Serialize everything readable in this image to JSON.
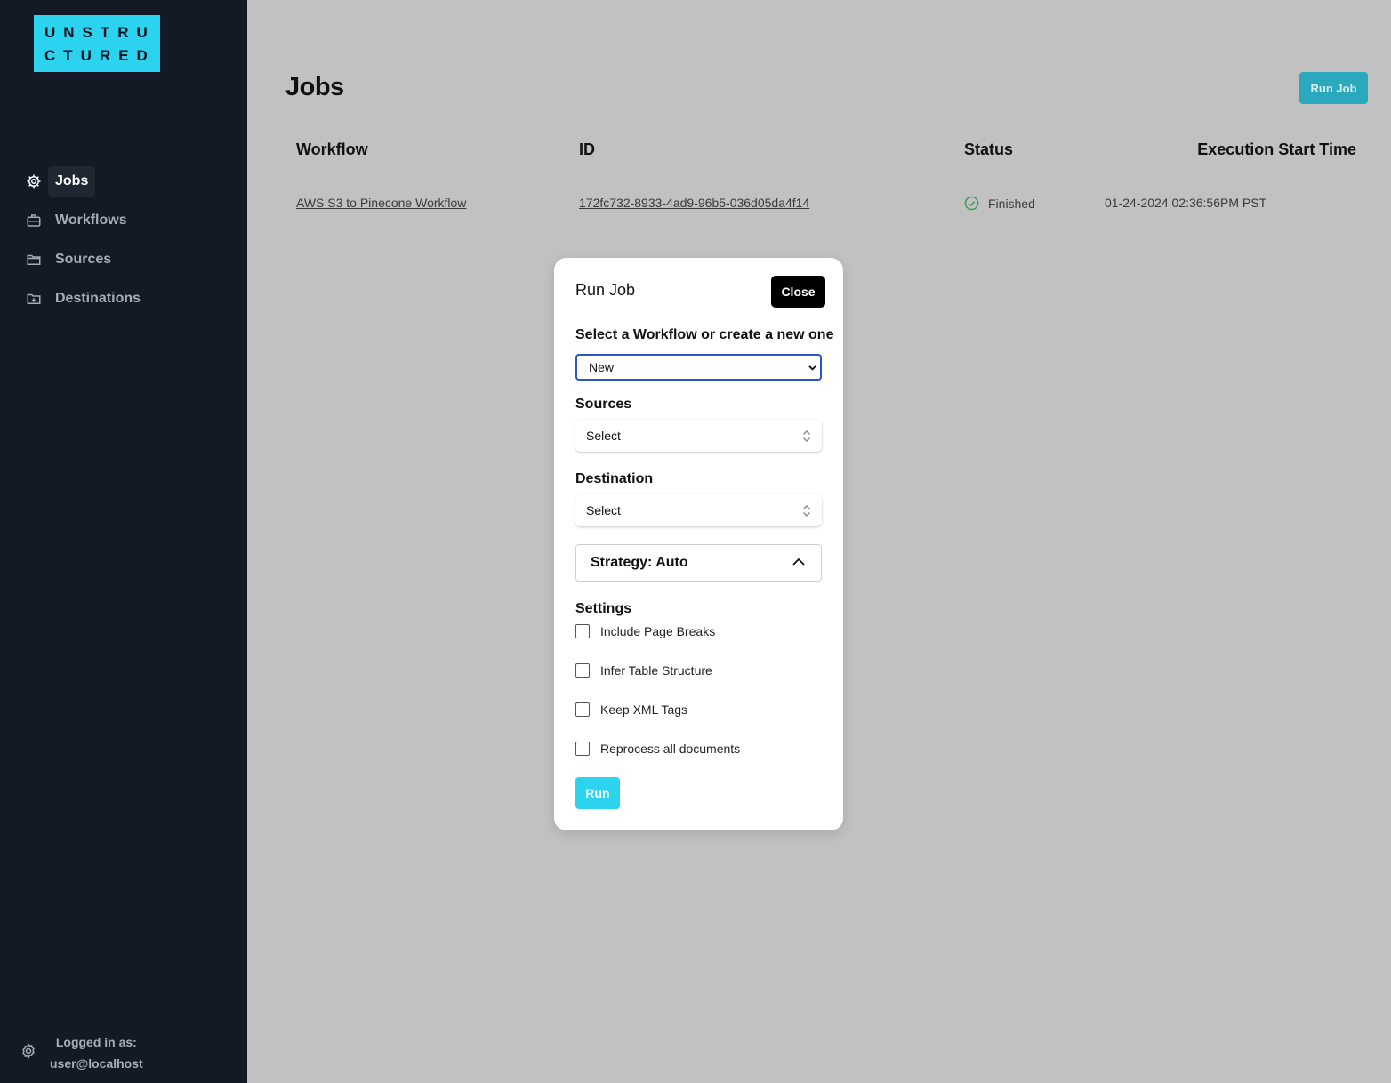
{
  "brand": {
    "logo_line1": "UNSTRU",
    "logo_line2": "CTURED"
  },
  "sidebar": {
    "items": [
      {
        "label": "Jobs",
        "icon": "gear-icon",
        "active": true
      },
      {
        "label": "Workflows",
        "icon": "briefcase-icon",
        "active": false
      },
      {
        "label": "Sources",
        "icon": "folder-icon",
        "active": false
      },
      {
        "label": "Destinations",
        "icon": "folder-download-icon",
        "active": false
      }
    ],
    "footer": {
      "line1": "Logged in as:",
      "line2": "user@localhost",
      "icon": "settings-icon"
    }
  },
  "main": {
    "title": "Jobs",
    "run_job_label": "Run Job",
    "table": {
      "headers": [
        "Workflow",
        "ID",
        "Status",
        "Execution Start Time"
      ],
      "rows": [
        {
          "workflow": "AWS S3 to Pinecone Workflow",
          "id": "172fc732-8933-4ad9-96b5-036d05da4f14",
          "status": "Finished",
          "start_time": "01-24-2024 02:36:56PM PST"
        }
      ]
    }
  },
  "modal": {
    "title": "Run Job",
    "close_label": "Close",
    "workflow_label": "Select a Workflow or create a new one",
    "workflow_value": "New",
    "sources_label": "Sources",
    "sources_value": "Select",
    "destination_label": "Destination",
    "destination_value": "Select",
    "strategy_label": "Strategy: Auto",
    "settings_label": "Settings",
    "settings": [
      {
        "label": "Include Page Breaks",
        "checked": false
      },
      {
        "label": "Infer Table Structure",
        "checked": false
      },
      {
        "label": "Keep XML Tags",
        "checked": false
      },
      {
        "label": "Reprocess all documents",
        "checked": false
      }
    ],
    "run_label": "Run"
  },
  "colors": {
    "sidebar_bg": "#131a26",
    "accent": "#2bd3ef",
    "overlay_bg": "#c1c1c1",
    "status_ok": "#2e9e4f"
  }
}
